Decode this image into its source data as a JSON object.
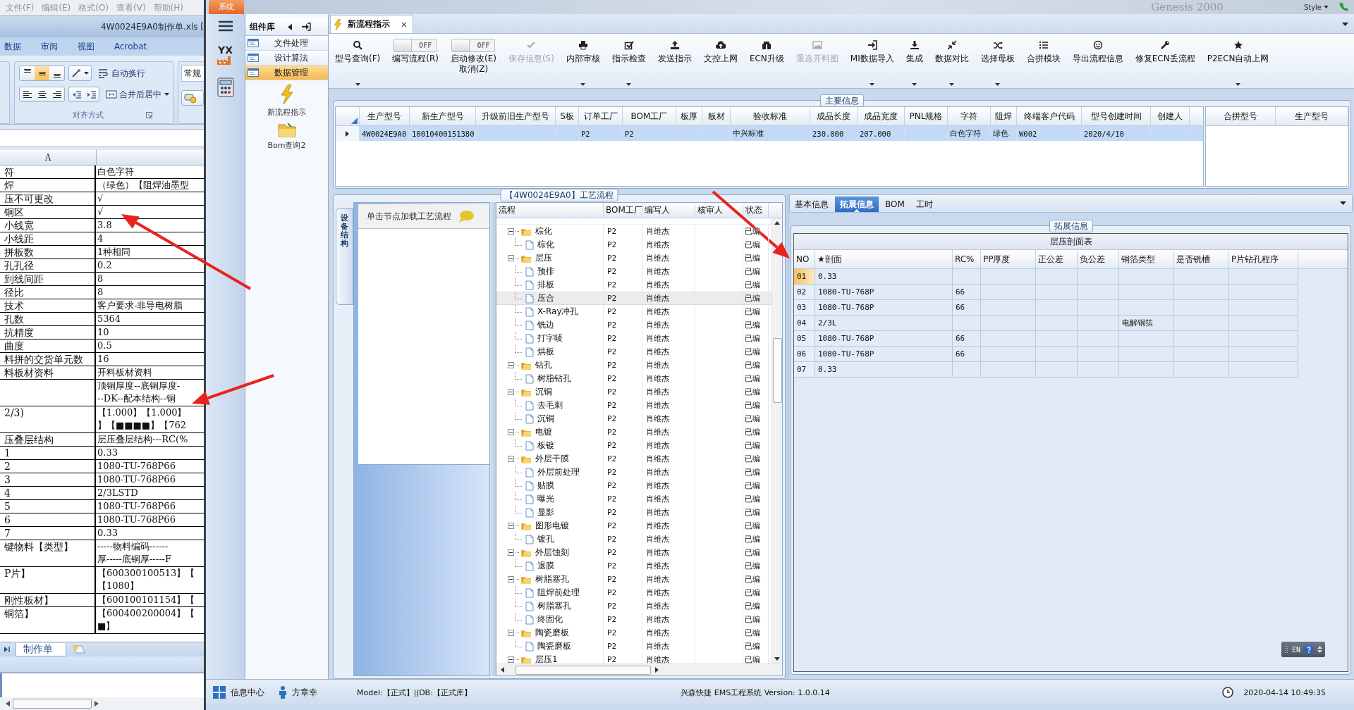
{
  "background_window": {
    "menu": [
      "文件(F)",
      "编辑(E)",
      "格式(O)",
      "查看(V)",
      "帮助(H)"
    ],
    "label": "Genesis 2000",
    "style_menu": "Style"
  },
  "spreadsheet": {
    "title": "4W0024E9A0制作单.xls [",
    "ribbon_tabs": [
      "数据",
      "审阅",
      "视图",
      "Acrobat"
    ],
    "align_buttons": [
      {
        "kind": "top",
        "selected": false
      },
      {
        "kind": "middle",
        "selected": true
      },
      {
        "kind": "bottom",
        "selected": false
      }
    ],
    "wrap_text": "自动换行",
    "merge_center": "合并后居中",
    "number_format": "常规",
    "group_label": "对齐方式",
    "column_header": "A",
    "rows": [
      {
        "label": "符",
        "lines": [
          "白色字符"
        ]
      },
      {
        "label": "焊",
        "lines": [
          "（绿色）【阻焊油墨型"
        ]
      },
      {
        "label": "压不可更改",
        "lines": [
          "√"
        ]
      },
      {
        "label": "铜区",
        "lines": [
          "√"
        ]
      },
      {
        "label": "小线宽",
        "lines": [
          "3.8"
        ]
      },
      {
        "label": "小线距",
        "lines": [
          "4"
        ]
      },
      {
        "label": "拼板数",
        "lines": [
          "1种相同"
        ]
      },
      {
        "label": "孔孔径",
        "lines": [
          "0.2"
        ]
      },
      {
        "label": "到线间距",
        "lines": [
          "8"
        ]
      },
      {
        "label": "径比",
        "lines": [
          "8"
        ]
      },
      {
        "label": "技术",
        "lines": [
          "客户要求-非导电树脂"
        ]
      },
      {
        "label": "孔数",
        "lines": [
          "5364"
        ]
      },
      {
        "label": "抗精度",
        "lines": [
          "10"
        ]
      },
      {
        "label": "曲度",
        "lines": [
          "0.5"
        ]
      },
      {
        "label": "料拼的交货单元数",
        "lines": [
          "16"
        ]
      },
      {
        "label": "料板材资料",
        "lines": [
          "开料板材资料"
        ]
      },
      {
        "lines": [
          "顶铜厚度--底铜厚度-",
          "--DK--配本结构--铜"
        ]
      },
      {
        "label": "2/3)",
        "lines": [
          "【1.000】【1.000】",
          "】【■■■■】【762"
        ]
      },
      {
        "label": "压叠层结构",
        "lines": [
          "层压叠层结构---RC(%"
        ]
      },
      {
        "label": "1",
        "lines": [
          "0.33"
        ]
      },
      {
        "label": "2",
        "lines": [
          "1080-TU-768P66"
        ]
      },
      {
        "label": "3",
        "lines": [
          "1080-TU-768P66"
        ]
      },
      {
        "label": "4",
        "lines": [
          "2/3LSTD"
        ]
      },
      {
        "label": "5",
        "lines": [
          "1080-TU-768P66"
        ]
      },
      {
        "label": "6",
        "lines": [
          "1080-TU-768P66"
        ]
      },
      {
        "label": "7",
        "lines": [
          "0.33"
        ]
      },
      {
        "label": "键物料【类型】",
        "lines": [
          "-----物料编码------",
          "厚-----底铜厚-----F"
        ]
      },
      {
        "label": "P片】",
        "lines": [
          "【600300100513】【",
          "【1080】"
        ]
      },
      {
        "label": "刚性板材】",
        "lines": [
          "【600100101154】【"
        ]
      },
      {
        "label": "铜箔】",
        "lines": [
          "【600400200004】【",
          "■】"
        ]
      }
    ],
    "sheet_tabs": [
      {
        "label": "制作单",
        "selected": true
      }
    ]
  },
  "app": {
    "system_tab": "系统",
    "logo_text": "YX",
    "components": {
      "title": "组件库",
      "items": [
        {
          "label": "文件处理",
          "selected": false
        },
        {
          "label": "设计算法",
          "selected": false
        },
        {
          "label": "数据管理",
          "selected": true
        }
      ],
      "launchers": [
        "新流程指示",
        "Bom查询2"
      ]
    },
    "document_tab": {
      "label": "新流程指示"
    },
    "toolbar": [
      {
        "kind": "button",
        "label": "型号查询(F)",
        "disabled": false,
        "has_menu": true
      },
      {
        "kind": "toggle",
        "label": "编写流程(R)",
        "switch_text": "OFF",
        "on": false,
        "disabled": false
      },
      {
        "kind": "toggle",
        "label": "启动修改(E)",
        "sub_label": "取消(Z)",
        "switch_text": "OFF",
        "on": false,
        "disabled": false
      },
      {
        "kind": "button",
        "label": "保存信息(S)",
        "disabled": true,
        "has_menu": false
      },
      {
        "kind": "button",
        "label": "内部审核",
        "disabled": false,
        "has_menu": true
      },
      {
        "kind": "button",
        "label": "指示检查",
        "disabled": false,
        "has_menu": true
      },
      {
        "kind": "button",
        "label": "发送指示",
        "disabled": false,
        "has_menu": false
      },
      {
        "kind": "button",
        "label": "文控上网",
        "disabled": false,
        "has_menu": false
      },
      {
        "kind": "button",
        "label": "ECN升级",
        "disabled": false,
        "has_menu": false
      },
      {
        "kind": "button",
        "label": "重选开料图",
        "disabled": true,
        "has_menu": false
      },
      {
        "kind": "button",
        "label": "MI数据导入",
        "disabled": false,
        "has_menu": true
      },
      {
        "kind": "button",
        "label": "集成",
        "disabled": false,
        "has_menu": true
      },
      {
        "kind": "button",
        "label": "数据对比",
        "disabled": false,
        "has_menu": true
      },
      {
        "kind": "button",
        "label": "选择母板",
        "disabled": false,
        "has_menu": true
      },
      {
        "kind": "button",
        "label": "合拼模块",
        "disabled": false,
        "has_menu": false
      },
      {
        "kind": "button",
        "label": "导出流程信息",
        "disabled": false,
        "has_menu": false
      },
      {
        "kind": "button",
        "label": "修复ECN丢流程",
        "disabled": false,
        "has_menu": false
      },
      {
        "kind": "button",
        "label": "P2ECN自动上网",
        "disabled": false,
        "has_menu": true
      }
    ],
    "main_info": {
      "title": "主要信息",
      "columns": [
        "生产型号",
        "新生产型号",
        "升级前旧生产型号",
        "S板",
        "订单工厂",
        "BOM工厂",
        "板厚",
        "板材",
        "验收标准",
        "成品长度",
        "成品宽度",
        "PNL规格",
        "字符",
        "阻焊",
        "终端客户代码",
        "型号创建时间",
        "创建人"
      ],
      "rows": [
        {
          "selected": true,
          "cells": [
            "4W0024E9A0",
            "10010400151380",
            null,
            null,
            "P2",
            "P2",
            null,
            null,
            "中兴标准",
            "230.000",
            "207.000",
            null,
            "白色字符",
            "绿色",
            "W002",
            "2020/4/10",
            null
          ]
        }
      ],
      "side_columns": [
        "合拼型号",
        "生产型号"
      ]
    },
    "process": {
      "title": "【4W0024E9A0】工艺流程",
      "side_tab": "设备结构",
      "hint": "单击节点加载工艺流程",
      "columns": [
        "流程",
        "BOM工厂",
        "编写人",
        "核审人",
        "状态"
      ],
      "tree": [
        {
          "kind": "folder",
          "name": "棕化",
          "factory": "P2",
          "writer": "肖维杰",
          "status": "已编",
          "expanded": true,
          "selected": false,
          "children": [
            {
              "kind": "step",
              "name": "棕化",
              "factory": "P2",
              "writer": "肖维杰",
              "status": "已编",
              "selected": false
            }
          ]
        },
        {
          "kind": "folder",
          "name": "层压",
          "factory": "P2",
          "writer": "肖维杰",
          "status": "已编",
          "expanded": true,
          "selected": false,
          "children": [
            {
              "kind": "step",
              "name": "预排",
              "factory": "P2",
              "writer": "肖维杰",
              "status": "已编",
              "selected": false
            },
            {
              "kind": "step",
              "name": "排板",
              "factory": "P2",
              "writer": "肖维杰",
              "status": "已编",
              "selected": false
            },
            {
              "kind": "step",
              "name": "压合",
              "factory": "P2",
              "writer": "肖维杰",
              "status": "已编",
              "selected": true
            },
            {
              "kind": "step",
              "name": "X-Ray冲孔",
              "factory": "P2",
              "writer": "肖维杰",
              "status": "已编",
              "selected": false
            },
            {
              "kind": "step",
              "name": "铣边",
              "factory": "P2",
              "writer": "肖维杰",
              "status": "已编",
              "selected": false
            },
            {
              "kind": "step",
              "name": "打字唛",
              "factory": "P2",
              "writer": "肖维杰",
              "status": "已编",
              "selected": false
            },
            {
              "kind": "step",
              "name": "烘板",
              "factory": "P2",
              "writer": "肖维杰",
              "status": "已编",
              "selected": false
            }
          ]
        },
        {
          "kind": "folder",
          "name": "钻孔",
          "factory": "P2",
          "writer": "肖维杰",
          "status": "已编",
          "expanded": true,
          "selected": false,
          "children": [
            {
              "kind": "step",
              "name": "树脂钻孔",
              "factory": "P2",
              "writer": "肖维杰",
              "status": "已编",
              "selected": false
            }
          ]
        },
        {
          "kind": "folder",
          "name": "沉铜",
          "factory": "P2",
          "writer": "肖维杰",
          "status": "已编",
          "expanded": true,
          "selected": false,
          "children": [
            {
              "kind": "step",
              "name": "去毛刺",
              "factory": "P2",
              "writer": "肖维杰",
              "status": "已编",
              "selected": false
            },
            {
              "kind": "step",
              "name": "沉铜",
              "factory": "P2",
              "writer": "肖维杰",
              "status": "已编",
              "selected": false
            }
          ]
        },
        {
          "kind": "folder",
          "name": "电镀",
          "factory": "P2",
          "writer": "肖维杰",
          "status": "已编",
          "expanded": true,
          "selected": false,
          "children": [
            {
              "kind": "step",
              "name": "板镀",
              "factory": "P2",
              "writer": "肖维杰",
              "status": "已编",
              "selected": false
            }
          ]
        },
        {
          "kind": "folder",
          "name": "外层干膜",
          "factory": "P2",
          "writer": "肖维杰",
          "status": "已编",
          "expanded": true,
          "selected": false,
          "children": [
            {
              "kind": "step",
              "name": "外层前处理",
              "factory": "P2",
              "writer": "肖维杰",
              "status": "已编",
              "selected": false
            },
            {
              "kind": "step",
              "name": "贴膜",
              "factory": "P2",
              "writer": "肖维杰",
              "status": "已编",
              "selected": false
            },
            {
              "kind": "step",
              "name": "曝光",
              "factory": "P2",
              "writer": "肖维杰",
              "status": "已编",
              "selected": false
            },
            {
              "kind": "step",
              "name": "显影",
              "factory": "P2",
              "writer": "肖维杰",
              "status": "已编",
              "selected": false
            }
          ]
        },
        {
          "kind": "folder",
          "name": "图形电镀",
          "factory": "P2",
          "writer": "肖维杰",
          "status": "已编",
          "expanded": true,
          "selected": false,
          "children": [
            {
              "kind": "step",
              "name": "镀孔",
              "factory": "P2",
              "writer": "肖维杰",
              "status": "已编",
              "selected": false
            }
          ]
        },
        {
          "kind": "folder",
          "name": "外层蚀刻",
          "factory": "P2",
          "writer": "肖维杰",
          "status": "已编",
          "expanded": true,
          "selected": false,
          "children": [
            {
              "kind": "step",
              "name": "退膜",
              "factory": "P2",
              "writer": "肖维杰",
              "status": "已编",
              "selected": false
            }
          ]
        },
        {
          "kind": "folder",
          "name": "树脂塞孔",
          "factory": "P2",
          "writer": "肖维杰",
          "status": "已编",
          "expanded": true,
          "selected": false,
          "children": [
            {
              "kind": "step",
              "name": "阻焊前处理",
              "factory": "P2",
              "writer": "肖维杰",
              "status": "已编",
              "selected": false
            },
            {
              "kind": "step",
              "name": "树脂塞孔",
              "factory": "P2",
              "writer": "肖维杰",
              "status": "已编",
              "selected": false
            },
            {
              "kind": "step",
              "name": "终固化",
              "factory": "P2",
              "writer": "肖维杰",
              "status": "已编",
              "selected": false
            }
          ]
        },
        {
          "kind": "folder",
          "name": "陶瓷磨板",
          "factory": "P2",
          "writer": "肖维杰",
          "status": "已编",
          "expanded": true,
          "selected": false,
          "children": [
            {
              "kind": "step",
              "name": "陶瓷磨板",
              "factory": "P2",
              "writer": "肖维杰",
              "status": "已编",
              "selected": false
            }
          ]
        },
        {
          "kind": "folder",
          "name": "层压1",
          "factory": "P2",
          "writer": "肖维杰",
          "status": "已编",
          "expanded": true,
          "selected": false
        }
      ]
    },
    "detail": {
      "tabs": [
        {
          "label": "基本信息",
          "selected": false
        },
        {
          "label": "拓展信息",
          "selected": true
        },
        {
          "label": "BOM",
          "selected": false
        },
        {
          "label": "工时",
          "selected": false
        }
      ],
      "group_title": "拓展信息",
      "table_title": "层压剖面表",
      "columns": [
        "NO",
        "★剖面",
        "RC%",
        "PP厚度",
        "正公差",
        "负公差",
        "铜箔类型",
        "是否铣槽",
        "P片钻孔程序"
      ],
      "rows": [
        {
          "selected": true,
          "cells": [
            "01",
            "0.33",
            null,
            null,
            null,
            null,
            null,
            null,
            null
          ]
        },
        {
          "selected": false,
          "cells": [
            "02",
            "1080-TU-768P",
            "66",
            null,
            null,
            null,
            null,
            null,
            null
          ]
        },
        {
          "selected": false,
          "cells": [
            "03",
            "1080-TU-768P",
            "66",
            null,
            null,
            null,
            null,
            null,
            null
          ]
        },
        {
          "selected": false,
          "cells": [
            "04",
            "2/3L",
            null,
            null,
            null,
            null,
            "电解铜箔",
            null,
            null
          ]
        },
        {
          "selected": false,
          "cells": [
            "05",
            "1080-TU-768P",
            "66",
            null,
            null,
            null,
            null,
            null,
            null
          ]
        },
        {
          "selected": false,
          "cells": [
            "06",
            "1080-TU-768P",
            "66",
            null,
            null,
            null,
            null,
            null,
            null
          ]
        },
        {
          "selected": false,
          "cells": [
            "07",
            "0.33",
            null,
            null,
            null,
            null,
            null,
            null,
            null
          ]
        }
      ],
      "language": "EN"
    },
    "status_bar": {
      "info_center": "信息中心",
      "user": "方章幸",
      "model": "Model:【正式】||DB:【正式库】",
      "product": "兴森快捷 EMS工程系统 Version: 1.0.0.14",
      "clock": "2020-04-14 10:49:35"
    }
  }
}
